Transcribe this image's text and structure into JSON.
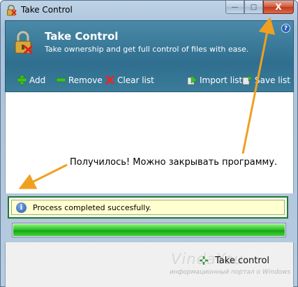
{
  "window": {
    "title": "Take Control",
    "buttons": {
      "minimize": "—",
      "maximize": "□",
      "close": "X"
    }
  },
  "header": {
    "title": "Take Control",
    "subtitle": "Take ownership and get full control of files with ease.",
    "help": "?"
  },
  "toolbar": {
    "add": "Add",
    "remove": "Remove",
    "clear": "Clear list",
    "import": "Import list",
    "save": "Save list"
  },
  "annotation": "Получилось! Можно закрывать программу.",
  "status": {
    "info_glyph": "i",
    "message": "Process completed succesfully."
  },
  "progress": {
    "value": 1.0
  },
  "action": {
    "take_control": "Take control"
  },
  "watermark": {
    "main": "VindaYou",
    "sub": "информационный портал о Windows"
  },
  "colors": {
    "header": "#2f6e8e",
    "status_bg": "#ffffcf",
    "progress": "#2fc42a",
    "arrow": "#f0a020"
  }
}
